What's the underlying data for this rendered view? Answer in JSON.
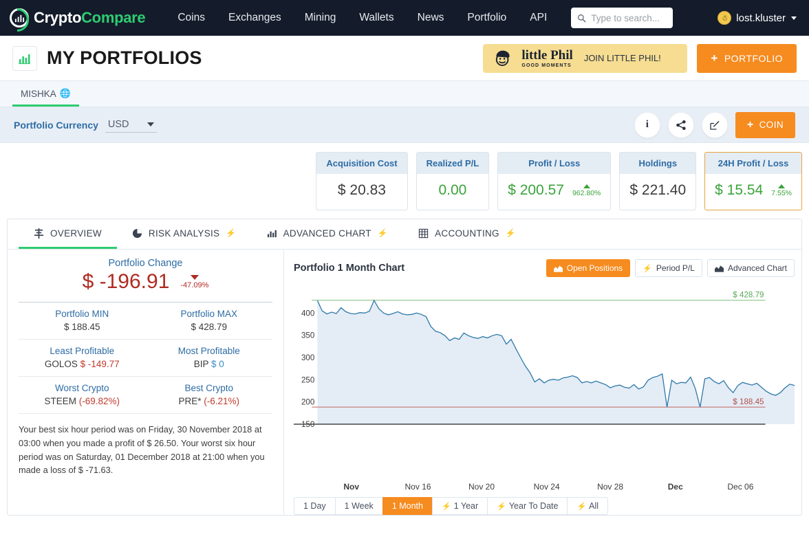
{
  "navbar": {
    "brand": {
      "part1": "Crypto",
      "part2": "Compare",
      "icon": "chart-logo-icon"
    },
    "links": [
      "Coins",
      "Exchanges",
      "Mining",
      "Wallets",
      "News",
      "Portfolio",
      "API"
    ],
    "search": {
      "placeholder": "Type to search...",
      "value": "",
      "icon": "search-icon"
    },
    "user": {
      "name": "lost.kluster",
      "avatar": "user-avatar"
    }
  },
  "header": {
    "icon": "bar-chart-icon",
    "title": "MY PORTFOLIOS",
    "promo": {
      "brand": "little Phil",
      "tagline": "GOOD MOMENTS",
      "cta": "JOIN LITTLE PHIL!"
    },
    "add_portfolio": "PORTFOLIO"
  },
  "portfolio_tabs": [
    {
      "label": "MISHKA",
      "icon": "globe-icon",
      "active": true
    }
  ],
  "currency_bar": {
    "label": "Portfolio Currency",
    "value": "USD",
    "actions": [
      {
        "name": "info-button",
        "glyph": "i"
      },
      {
        "name": "share-button",
        "glyph": "share"
      },
      {
        "name": "edit-button",
        "glyph": "edit"
      }
    ],
    "add_coin": "COIN"
  },
  "stats": [
    {
      "label": "Acquisition Cost",
      "value": "$ 20.83",
      "value_color": "#3c3c3c",
      "pct": null,
      "highlight": false
    },
    {
      "label": "Realized P/L",
      "value": "0.00",
      "value_color": "#3aa33a",
      "pct": null,
      "highlight": false
    },
    {
      "label": "Profit / Loss",
      "value": "$ 200.57",
      "value_color": "#3aa33a",
      "pct": "962.80%",
      "pct_dir": "up",
      "highlight": false
    },
    {
      "label": "Holdings",
      "value": "$ 221.40",
      "value_color": "#3c3c3c",
      "pct": null,
      "highlight": false
    },
    {
      "label": "24H Profit / Loss",
      "value": "$ 15.54",
      "value_color": "#3aa33a",
      "pct": "7.55%",
      "pct_dir": "up",
      "highlight": true
    }
  ],
  "view_tabs": [
    {
      "label": "OVERVIEW",
      "icon": "overview-icon",
      "bolt": false,
      "active": true
    },
    {
      "label": "RISK ANALYSIS",
      "icon": "pie-chart-icon",
      "bolt": true,
      "active": false
    },
    {
      "label": "ADVANCED CHART",
      "icon": "bar-chart-icon",
      "bolt": true,
      "active": false
    },
    {
      "label": "ACCOUNTING",
      "icon": "table-icon",
      "bolt": true,
      "active": false
    }
  ],
  "overview": {
    "change_title": "Portfolio Change",
    "change_value": "$ -196.91",
    "change_pct": "-47.09%",
    "change_dir": "down",
    "pairs": [
      {
        "left_label": "Portfolio MIN",
        "left_value": "$ 188.45",
        "right_label": "Portfolio MAX",
        "right_value": "$ 428.79"
      },
      {
        "left_label": "Least Profitable",
        "left_sym": "GOLOS",
        "left_value": "$ -149.77",
        "left_color": "red",
        "right_label": "Most Profitable",
        "right_sym": "BIP",
        "right_value": "$ 0",
        "right_color": "blue"
      },
      {
        "left_label": "Worst Crypto",
        "left_sym": "STEEM",
        "left_value": "(-69.82%)",
        "left_color": "red",
        "right_label": "Best Crypto",
        "right_sym": "PRE*",
        "right_value": "(-6.21%)",
        "right_color": "red"
      }
    ],
    "summary": "Your best six hour period was on Friday, 30 November 2018 at 03:00 when you made a profit of $ 26.50. Your worst six hour period was on Saturday, 01 December 2018 at 21:00 when you made a loss of $ -71.63."
  },
  "chart_panel": {
    "title": "Portfolio 1 Month Chart",
    "mode_buttons": [
      {
        "label": "Open Positions",
        "icon": "area-chart-icon",
        "active": true
      },
      {
        "label": "Period P/L",
        "icon": "bolt-icon",
        "active": false
      },
      {
        "label": "Advanced Chart",
        "icon": "area-chart-icon",
        "active": false
      }
    ],
    "ranges": [
      {
        "label": "1 Day",
        "bolt": false,
        "active": false
      },
      {
        "label": "1 Week",
        "bolt": false,
        "active": false
      },
      {
        "label": "1 Month",
        "bolt": false,
        "active": true
      },
      {
        "label": "1 Year",
        "bolt": true,
        "active": false
      },
      {
        "label": "Year To Date",
        "bolt": true,
        "active": false
      },
      {
        "label": "All",
        "bolt": true,
        "active": false
      }
    ]
  },
  "chart_data": {
    "type": "area",
    "title": "Portfolio 1 Month Chart",
    "xlabel": "",
    "ylabel": "",
    "ylim": [
      150,
      450
    ],
    "yticks": [
      150,
      200,
      250,
      300,
      350,
      400
    ],
    "grid": false,
    "legend": false,
    "line_color": "#2e79a8",
    "fill_color": "#e4ecf6",
    "max_line": {
      "value": 428.79,
      "label": "$ 428.79",
      "color": "#7dbf7d"
    },
    "min_line": {
      "value": 188.45,
      "label": "$ 188.45",
      "color": "#c0655e"
    },
    "xticks": [
      {
        "label": "Nov",
        "bold": true,
        "pos": 0.115
      },
      {
        "label": "Nov 16",
        "bold": false,
        "pos": 0.248
      },
      {
        "label": "Nov 20",
        "bold": false,
        "pos": 0.375
      },
      {
        "label": "Nov 24",
        "bold": false,
        "pos": 0.505
      },
      {
        "label": "Nov 28",
        "bold": false,
        "pos": 0.632
      },
      {
        "label": "Dec",
        "bold": true,
        "pos": 0.762
      },
      {
        "label": "Dec 06",
        "bold": false,
        "pos": 0.892
      }
    ],
    "values": [
      428.0,
      405.0,
      398.0,
      402.0,
      399.0,
      412.0,
      403.0,
      399.0,
      398.0,
      401.0,
      400.0,
      404.0,
      428.5,
      410.0,
      400.0,
      396.0,
      399.0,
      403.0,
      398.0,
      396.0,
      397.0,
      400.0,
      397.0,
      392.0,
      370.0,
      359.0,
      356.0,
      349.0,
      338.0,
      344.0,
      341.0,
      355.0,
      349.0,
      345.0,
      343.0,
      347.0,
      344.0,
      349.0,
      352.0,
      349.0,
      330.0,
      341.0,
      320.0,
      300.0,
      281.0,
      266.0,
      245.0,
      252.0,
      243.0,
      249.0,
      251.0,
      249.0,
      254.0,
      256.0,
      259.0,
      255.0,
      243.0,
      246.0,
      243.0,
      247.0,
      243.0,
      239.0,
      232.0,
      236.0,
      238.0,
      233.0,
      231.0,
      239.0,
      229.0,
      234.0,
      249.0,
      255.0,
      258.0,
      263.0,
      188.5,
      249.0,
      241.0,
      244.0,
      243.0,
      256.0,
      230.0,
      188.5,
      252.0,
      255.0,
      246.0,
      241.0,
      248.0,
      232.0,
      221.0,
      237.0,
      244.0,
      241.0,
      238.0,
      242.0,
      233.0,
      224.0,
      218.0,
      215.0,
      221.0,
      232.0,
      240.0,
      237.0
    ]
  }
}
